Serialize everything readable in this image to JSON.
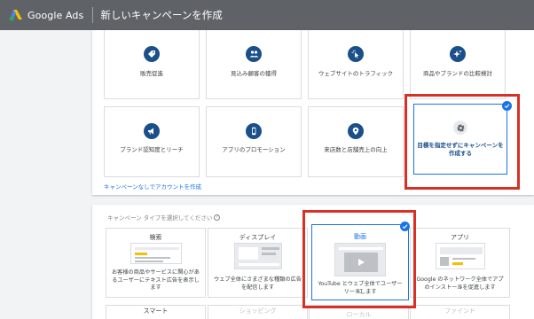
{
  "header": {
    "brand": "Google Ads",
    "title": "新しいキャンペーンを作成"
  },
  "goals": {
    "row1": [
      {
        "label": "販売促進",
        "icon": "tag-icon"
      },
      {
        "label": "見込み顧客の獲得",
        "icon": "people-icon"
      },
      {
        "label": "ウェブサイトのトラフィック",
        "icon": "cursor-click-icon"
      },
      {
        "label": "商品やブランドの比較検討",
        "icon": "sparkle-icon"
      }
    ],
    "row2": [
      {
        "label": "ブランド認知度とリーチ",
        "icon": "megaphone-icon"
      },
      {
        "label": "アプリのプロモーション",
        "icon": "phone-icon"
      },
      {
        "label": "来店数と店舗売上の向上",
        "icon": "location-pin-icon"
      }
    ],
    "no_goal": {
      "line1": "目標を指定せずにキャンペーンを",
      "line2": "作成する",
      "icon": "gear-icon",
      "selected": true
    },
    "no_account_link": "キャンペーンなしでアカウントを作成"
  },
  "campaign_types": {
    "prompt": "キャンペーン タイプを選択してください",
    "help": "?",
    "tiles": [
      {
        "title": "検索",
        "desc_lines": [
          "お客様の商品やサービスに関心があ",
          "るユーザーにテキスト広告を表示し",
          "ます"
        ]
      },
      {
        "title": "ディスプレイ",
        "desc_lines": [
          "ウェブ全体にさまざまな種類の広告",
          "を配信します"
        ]
      },
      {
        "title": "動画",
        "desc_lines": [
          "YouTube とウェブ全体でユーザーに",
          "リーチします"
        ],
        "selected": true
      },
      {
        "title": "アプリ",
        "desc_lines": [
          "Google のネットワーク全体でアプリ",
          "のインストールを促進します"
        ]
      }
    ],
    "row2": [
      "スマート",
      "ショッピング",
      "ローカル",
      "ファインド"
    ]
  },
  "colors": {
    "header_bg": "#5f6368",
    "accent": "#1a73e8",
    "icon_navy": "#1a4f8a",
    "highlight": "#d93025"
  }
}
